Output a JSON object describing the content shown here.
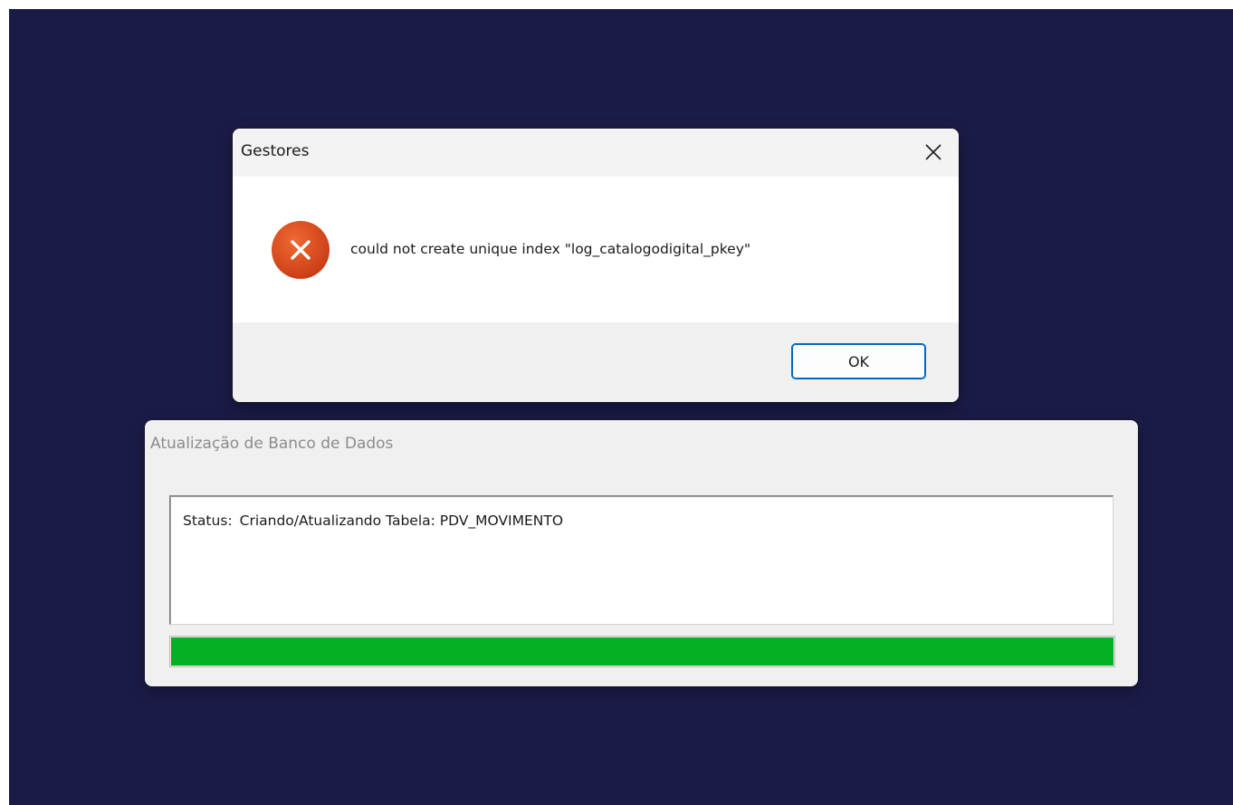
{
  "error_dialog": {
    "title": "Gestores",
    "message": "could not create unique index \"log_catalogodigital_pkey\"",
    "icon": "error-icon",
    "ok_label": "OK",
    "close_icon": "close-icon"
  },
  "progress_window": {
    "title": "Atualização de Banco de Dados",
    "status_label": "Status:",
    "status_text": "Criando/Atualizando Tabela: PDV_MOVIMENTO",
    "progress_percent": 100
  },
  "colors": {
    "desktop_background": "#1b1b47",
    "error_icon": "#d8461c",
    "progress_fill": "#06b025",
    "button_accent": "#0067c0"
  }
}
